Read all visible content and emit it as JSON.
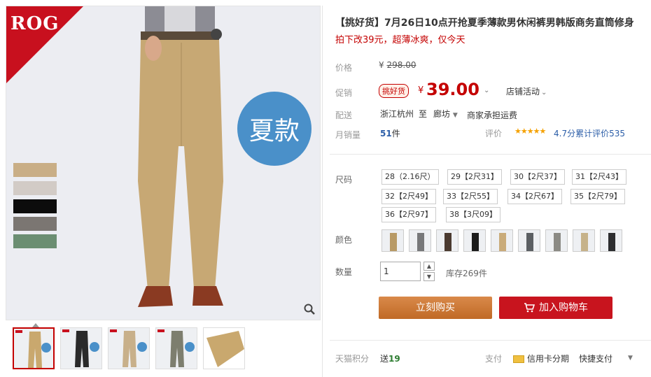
{
  "gallery": {
    "brand": "ROG",
    "badge": "夏款",
    "swatches": [
      "#c9ae86",
      "#d2cbc6",
      "#0c0c0c",
      "#7b7672",
      "#6b8e72"
    ],
    "thumbnail_colors": [
      "#c9a86e",
      "#2a2a2a",
      "#c8b08a",
      "#7d7e6e",
      "#c9a86e"
    ]
  },
  "product": {
    "title": "【挑好货】7月26日10点开抢夏季薄款男休闲裤男韩版商务直筒修身",
    "subtitle": "拍下改39元，超薄冰爽，仅今天",
    "price_label": "价格",
    "original_price_symbol": "¥",
    "original_price": "298.00",
    "promo_label": "促销",
    "promo_tag": "挑好货",
    "price_symbol": "¥",
    "price": "39.00",
    "shop_activity": "店铺活动",
    "shipping_label": "配送",
    "ship_from": "浙江杭州",
    "ship_to_word": "至",
    "ship_to": "廊坊",
    "ship_fee": "商家承担运费",
    "sales_label": "月销量",
    "sales_count": "51",
    "sales_unit": "件",
    "rating_label": "评价",
    "stars": "★★★★★",
    "rating_text": "4.7分累计评价535"
  },
  "options": {
    "size_label": "尺码",
    "sizes": [
      "28（2.16尺）",
      "29【2尺31】",
      "30【2尺37】",
      "31【2尺43】",
      "32【2尺49】",
      "33【2尺55】",
      "34【2尺67】",
      "35【2尺79】",
      "36【2尺97】",
      "38【3尺09】"
    ],
    "color_label": "颜色",
    "colors": [
      "#b89a66",
      "#77787a",
      "#4a3a30",
      "#1c1c1c",
      "#c9ab7a",
      "#5b5f63",
      "#8b8a84",
      "#c6b28a",
      "#2d2e30"
    ],
    "qty_label": "数量",
    "qty_value": "1",
    "stock": "库存269件"
  },
  "actions": {
    "buy_now": "立刻购买",
    "add_to_cart": "加入购物车"
  },
  "footer": {
    "points_label": "天猫积分",
    "points_prefix": "送",
    "points_value": "19",
    "pay_label": "支付",
    "credit_installment": "信用卡分期",
    "quick_pay": "快捷支付"
  }
}
